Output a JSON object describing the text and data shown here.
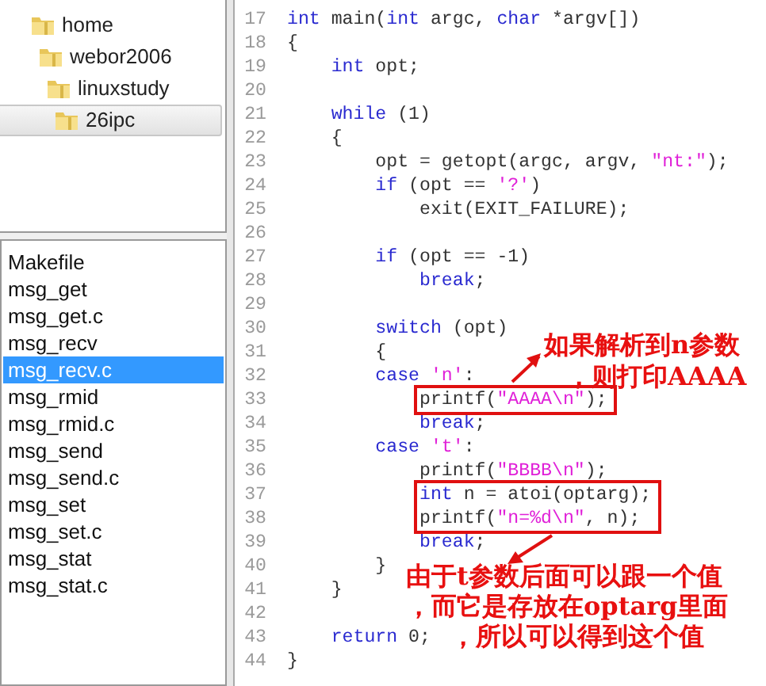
{
  "folder_tree": [
    {
      "label": "home",
      "selected": false,
      "children": [
        {
          "label": "webor2006",
          "selected": false,
          "children": [
            {
              "label": "linuxstudy",
              "selected": false,
              "children": [
                {
                  "label": "26ipc",
                  "selected": true
                }
              ]
            }
          ]
        }
      ]
    }
  ],
  "files": [
    {
      "name": "Makefile",
      "selected": false
    },
    {
      "name": "msg_get",
      "selected": false
    },
    {
      "name": "msg_get.c",
      "selected": false
    },
    {
      "name": "msg_recv",
      "selected": false
    },
    {
      "name": "msg_recv.c",
      "selected": true
    },
    {
      "name": "msg_rmid",
      "selected": false
    },
    {
      "name": "msg_rmid.c",
      "selected": false
    },
    {
      "name": "msg_send",
      "selected": false
    },
    {
      "name": "msg_send.c",
      "selected": false
    },
    {
      "name": "msg_set",
      "selected": false
    },
    {
      "name": "msg_set.c",
      "selected": false
    },
    {
      "name": "msg_stat",
      "selected": false
    },
    {
      "name": "msg_stat.c",
      "selected": false
    }
  ],
  "code_lines": [
    {
      "number": "17",
      "highlighted": false,
      "tokens": [
        {
          "kind": "keyword",
          "text": "int"
        },
        {
          "kind": "plain",
          "text": " main("
        },
        {
          "kind": "keyword",
          "text": "int"
        },
        {
          "kind": "plain",
          "text": " argc, "
        },
        {
          "kind": "keyword",
          "text": "char"
        },
        {
          "kind": "plain",
          "text": " *argv[])"
        }
      ]
    },
    {
      "number": "18",
      "highlighted": false,
      "tokens": [
        {
          "kind": "plain",
          "text": "{"
        }
      ]
    },
    {
      "number": "19",
      "highlighted": false,
      "tokens": [
        {
          "kind": "keyword",
          "text": "    int"
        },
        {
          "kind": "plain",
          "text": " opt;"
        }
      ]
    },
    {
      "number": "20",
      "highlighted": false
    },
    {
      "number": "21",
      "highlighted": false,
      "tokens": [
        {
          "kind": "keyword",
          "text": "    while"
        },
        {
          "kind": "plain",
          "text": " (1)"
        }
      ]
    },
    {
      "number": "22",
      "highlighted": false,
      "tokens": [
        {
          "kind": "plain",
          "text": "    {"
        }
      ]
    },
    {
      "number": "23",
      "highlighted": false,
      "tokens": [
        {
          "kind": "plain",
          "text": "        opt = getopt(argc, argv, "
        },
        {
          "kind": "string",
          "text": "\"nt:\""
        },
        {
          "kind": "plain",
          "text": ");"
        }
      ]
    },
    {
      "number": "24",
      "highlighted": false,
      "tokens": [
        {
          "kind": "keyword",
          "text": "        if"
        },
        {
          "kind": "plain",
          "text": " (opt == "
        },
        {
          "kind": "string",
          "text": "'?'"
        },
        {
          "kind": "plain",
          "text": ")"
        }
      ]
    },
    {
      "number": "25",
      "highlighted": false,
      "tokens": [
        {
          "kind": "plain",
          "text": "            exit(EXIT_FAILURE);"
        }
      ]
    },
    {
      "number": "26",
      "highlighted": false
    },
    {
      "number": "27",
      "highlighted": false,
      "tokens": [
        {
          "kind": "keyword",
          "text": "        if"
        },
        {
          "kind": "plain",
          "text": " (opt == -1)"
        }
      ]
    },
    {
      "number": "28",
      "highlighted": false,
      "tokens": [
        {
          "kind": "keyword",
          "text": "            break"
        },
        {
          "kind": "plain",
          "text": ";"
        }
      ]
    },
    {
      "number": "29",
      "highlighted": false
    },
    {
      "number": "30",
      "highlighted": false,
      "tokens": [
        {
          "kind": "keyword",
          "text": "        switch"
        },
        {
          "kind": "plain",
          "text": " (opt)"
        }
      ]
    },
    {
      "number": "31",
      "highlighted": false,
      "tokens": [
        {
          "kind": "plain",
          "text": "        {"
        }
      ]
    },
    {
      "number": "32",
      "highlighted": false,
      "tokens": [
        {
          "kind": "keyword",
          "text": "        case"
        },
        {
          "kind": "string",
          "text": " 'n'"
        },
        {
          "kind": "plain",
          "text": ":"
        }
      ]
    },
    {
      "number": "33",
      "highlighted": true,
      "tokens": [
        {
          "kind": "plain",
          "text": "            printf("
        },
        {
          "kind": "string",
          "text": "\"AAAA\\n\""
        },
        {
          "kind": "plain",
          "text": ");"
        }
      ]
    },
    {
      "number": "34",
      "highlighted": false,
      "tokens": [
        {
          "kind": "keyword",
          "text": "            break"
        },
        {
          "kind": "plain",
          "text": ";"
        }
      ]
    },
    {
      "number": "35",
      "highlighted": false,
      "tokens": [
        {
          "kind": "keyword",
          "text": "        case"
        },
        {
          "kind": "string",
          "text": " 't'"
        },
        {
          "kind": "plain",
          "text": ":"
        }
      ]
    },
    {
      "number": "36",
      "highlighted": false,
      "tokens": [
        {
          "kind": "plain",
          "text": "            printf("
        },
        {
          "kind": "string",
          "text": "\"BBBB\\n\""
        },
        {
          "kind": "plain",
          "text": ");"
        }
      ]
    },
    {
      "number": "37",
      "highlighted": true,
      "tokens": [
        {
          "kind": "keyword",
          "text": "            int"
        },
        {
          "kind": "plain",
          "text": " n = atoi(optarg);"
        }
      ]
    },
    {
      "number": "38",
      "highlighted": true,
      "tokens": [
        {
          "kind": "plain",
          "text": "            printf("
        },
        {
          "kind": "string",
          "text": "\"n=%d\\n\""
        },
        {
          "kind": "plain",
          "text": ", n);"
        }
      ]
    },
    {
      "number": "39",
      "highlighted": false,
      "tokens": [
        {
          "kind": "keyword",
          "text": "            break"
        },
        {
          "kind": "plain",
          "text": ";"
        }
      ]
    },
    {
      "number": "40",
      "highlighted": false,
      "tokens": [
        {
          "kind": "plain",
          "text": "        }"
        }
      ]
    },
    {
      "number": "41",
      "highlighted": false,
      "tokens": [
        {
          "kind": "plain",
          "text": "    }"
        }
      ]
    },
    {
      "number": "42",
      "highlighted": false
    },
    {
      "number": "43",
      "highlighted": false,
      "tokens": [
        {
          "kind": "keyword",
          "text": "    return"
        },
        {
          "kind": "plain",
          "text": " 0;"
        }
      ]
    },
    {
      "number": "44",
      "highlighted": false,
      "tokens": [
        {
          "kind": "plain",
          "text": "}"
        }
      ]
    }
  ],
  "annotations": [
    {
      "lines": [
        "如果解析到n参数",
        "，则打印AAAA"
      ]
    },
    {
      "lines": [
        "由于t参数后面可以跟一个值",
        "，而它是存放在optarg里面",
        "，所以可以得到这个值"
      ]
    }
  ]
}
